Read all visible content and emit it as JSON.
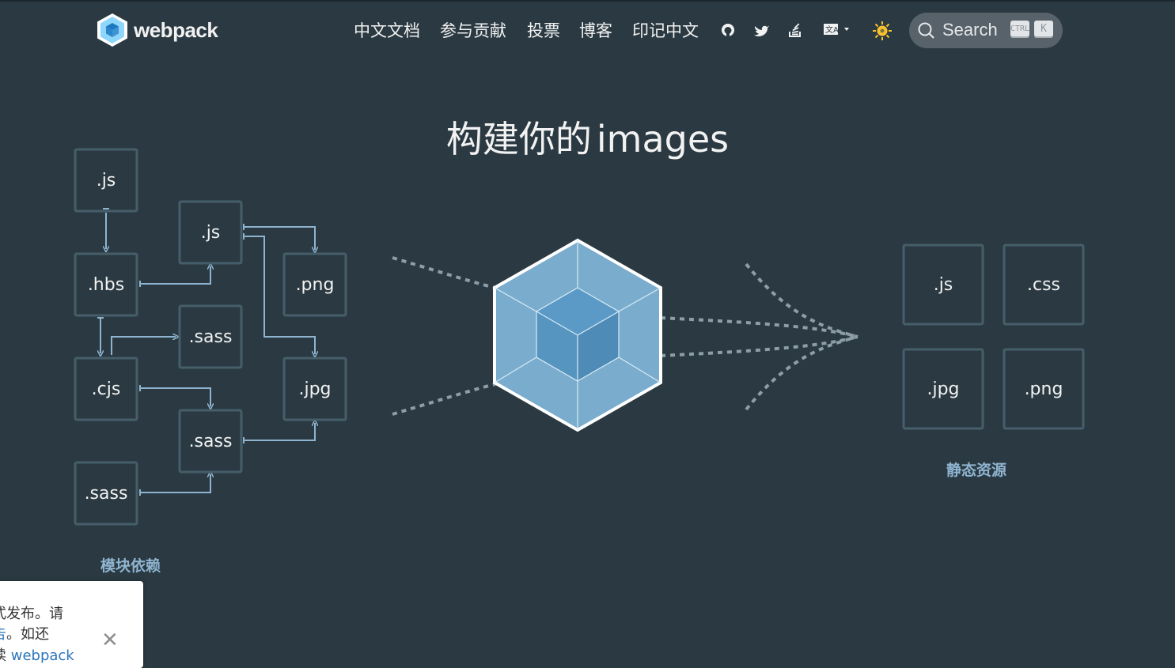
{
  "brand": {
    "name": "webpack"
  },
  "nav": {
    "links": [
      "中文文档",
      "参与贡献",
      "投票",
      "博客",
      "印记中文"
    ],
    "icons": [
      "github-icon",
      "twitter-icon",
      "stack-overflow-icon",
      "language-icon",
      "theme-toggle-icon"
    ]
  },
  "search": {
    "label": "Search",
    "shortcut": [
      "CTRL",
      "K"
    ]
  },
  "hero": {
    "prefix": "构建你的",
    "word": "images"
  },
  "diagram": {
    "modules": [
      ".js",
      ".js",
      ".hbs",
      ".png",
      ".sass",
      ".cjs",
      ".jpg",
      ".sass",
      ".sass"
    ],
    "modules_caption": "模块依赖",
    "assets": [
      ".js",
      ".css",
      ".jpg",
      ".png"
    ],
    "assets_caption": "静态资源"
  },
  "notice": {
    "line1": "式发布。请",
    "line2_link": "告",
    "line2_rest": "。如还",
    "line3_prefix": "读 ",
    "line3_link": "webpack"
  },
  "colors": {
    "background": "#2b3a42",
    "box_border": "#465e69",
    "arrow": "#8fb4d0",
    "cube_light": "#8ed6fb",
    "cube_dark": "#1c78c0"
  }
}
